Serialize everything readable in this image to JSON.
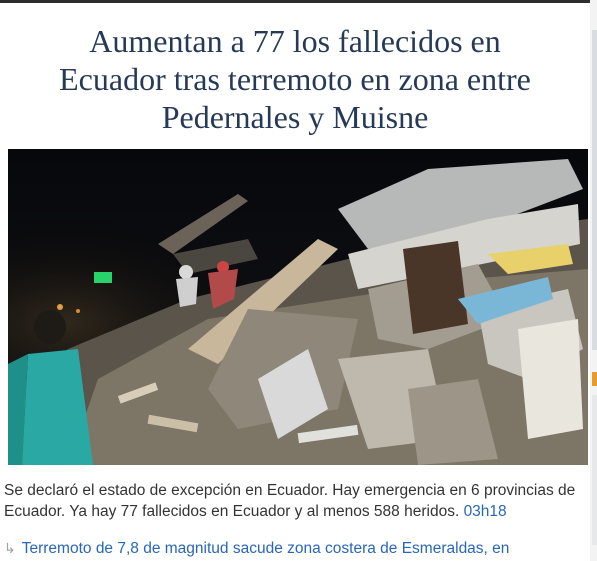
{
  "article": {
    "headline_lines": [
      "Aumentan a 77 los fallecidos en",
      "Ecuador tras terremoto en zona entre",
      "Pedernales y Muisne"
    ],
    "photo_alt": "",
    "caption": "Se declaró el estado de excepción en Ecuador. Hay emergencia en 6 provincias de Ecuador. Ya hay 77 fallecidos en Ecuador y al menos 588 heridos.",
    "caption_time": "03h18",
    "related_link": "Terremoto de 7,8 de magnitud sacude zona costera de Esmeraldas, en",
    "related_icon": "reply-arrow-icon"
  },
  "colors": {
    "headline": "#263a57",
    "link": "#2a66b8",
    "body_text": "#333333"
  }
}
